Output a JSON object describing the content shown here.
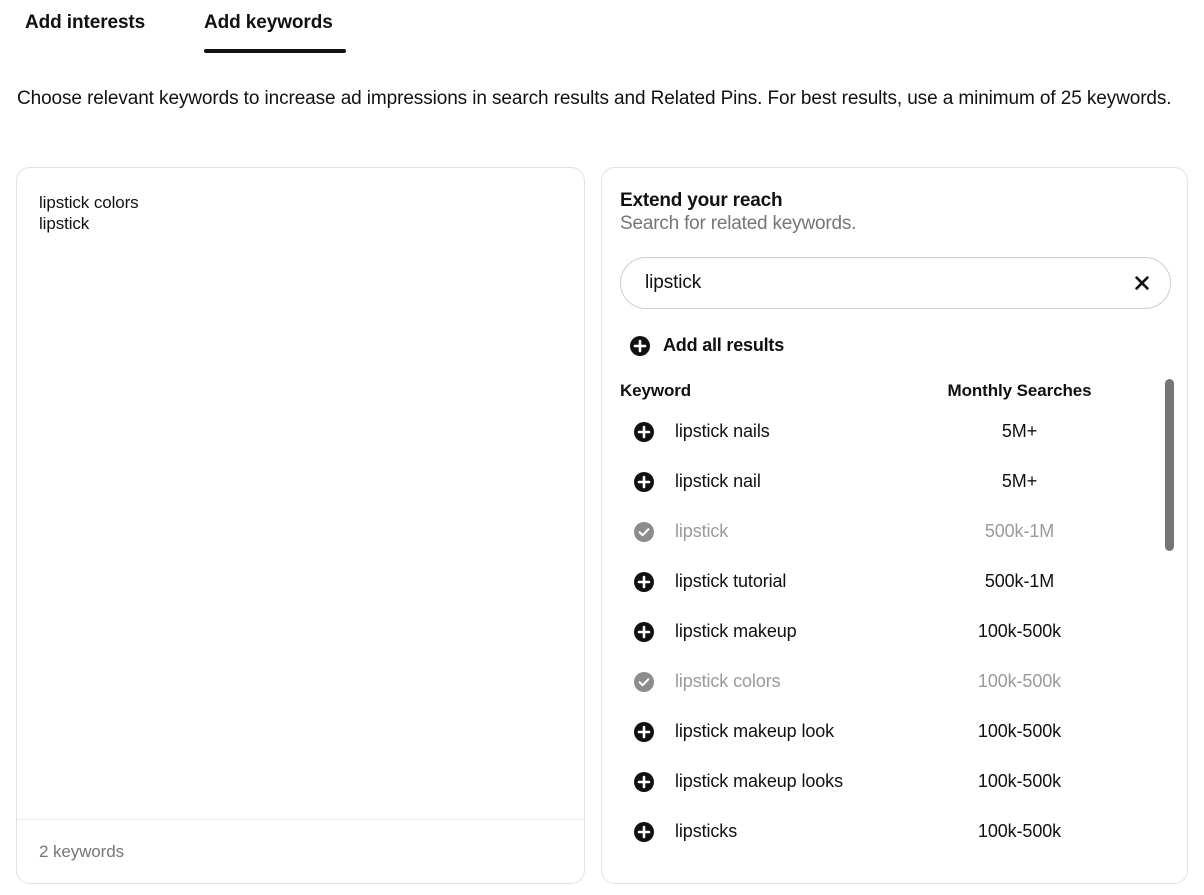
{
  "tabs": [
    {
      "label": "Add interests",
      "active": false
    },
    {
      "label": "Add keywords",
      "active": true
    }
  ],
  "description": "Choose relevant keywords to increase ad impressions in search results and Related Pins. For best results, use a minimum of 25 keywords.",
  "left_panel": {
    "selected_keywords": [
      "lipstick colors",
      "lipstick"
    ],
    "footer_count": "2 keywords"
  },
  "right_panel": {
    "title": "Extend your reach",
    "subtitle": "Search for related keywords.",
    "search": {
      "value": "lipstick",
      "placeholder": "Search for related keywords",
      "clear_icon": "close-icon"
    },
    "add_all": {
      "label": "Add all results",
      "icon": "plus-circle-icon"
    },
    "columns": {
      "keyword": "Keyword",
      "monthly_searches": "Monthly Searches"
    },
    "results": [
      {
        "keyword": "lipstick nails",
        "monthly_searches": "5M+",
        "added": false,
        "icon": "plus-circle-icon"
      },
      {
        "keyword": "lipstick nail",
        "monthly_searches": "5M+",
        "added": false,
        "icon": "plus-circle-icon"
      },
      {
        "keyword": "lipstick",
        "monthly_searches": "500k-1M",
        "added": true,
        "icon": "check-circle-icon"
      },
      {
        "keyword": "lipstick tutorial",
        "monthly_searches": "500k-1M",
        "added": false,
        "icon": "plus-circle-icon"
      },
      {
        "keyword": "lipstick makeup",
        "monthly_searches": "100k-500k",
        "added": false,
        "icon": "plus-circle-icon"
      },
      {
        "keyword": "lipstick colors",
        "monthly_searches": "100k-500k",
        "added": true,
        "icon": "check-circle-icon"
      },
      {
        "keyword": "lipstick makeup look",
        "monthly_searches": "100k-500k",
        "added": false,
        "icon": "plus-circle-icon"
      },
      {
        "keyword": "lipstick makeup looks",
        "monthly_searches": "100k-500k",
        "added": false,
        "icon": "plus-circle-icon"
      },
      {
        "keyword": "lipsticks",
        "monthly_searches": "100k-500k",
        "added": false,
        "icon": "plus-circle-icon"
      }
    ]
  },
  "colors": {
    "text": "#111111",
    "muted": "#767676",
    "disabled": "#9a9a9a",
    "border": "#e1e1e1",
    "accent": "#111111"
  }
}
